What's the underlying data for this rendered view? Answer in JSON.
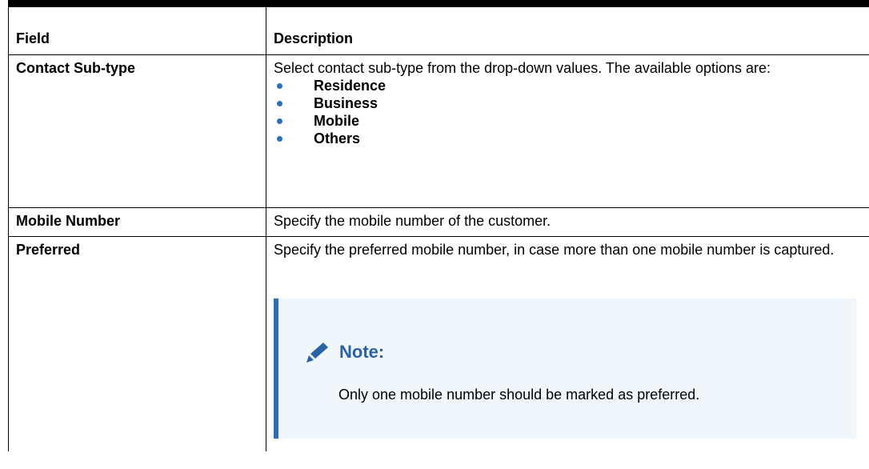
{
  "table": {
    "header": {
      "field": "Field",
      "description": "Description"
    },
    "rows": [
      {
        "field": "Contact Sub-type",
        "description": "Select contact sub-type from the drop-down values. The available options are:",
        "options": [
          "Residence",
          "Business",
          "Mobile",
          "Others"
        ]
      },
      {
        "field": "Mobile Number",
        "description": "Specify the mobile number of the customer."
      },
      {
        "field": "Preferred",
        "description": "Specify the preferred mobile number, in case more than one mobile number is captured.",
        "note": {
          "title": "Note:",
          "text": "Only one mobile number should be marked as preferred.",
          "icon": "pencil-icon"
        }
      }
    ]
  },
  "colors": {
    "accent": "#2c6fb7",
    "note_title": "#2a62a6",
    "note_bg": "#f1f6fb"
  }
}
